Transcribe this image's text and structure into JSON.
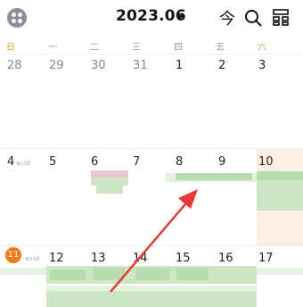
{
  "header": {
    "month": "2023.06",
    "today_label": "今",
    "icons": {
      "menu": "dots-grid-icon",
      "search": "search-icon",
      "layout": "layout-grid-icon"
    }
  },
  "weekdays": [
    "日",
    "一",
    "二",
    "三",
    "四",
    "五",
    "六"
  ],
  "weeks": [
    {
      "days": [
        "28",
        "29",
        "30",
        "31",
        "1",
        "2",
        "3"
      ],
      "weeknum": ""
    },
    {
      "days": [
        "4",
        "5",
        "6",
        "7",
        "8",
        "9",
        "10"
      ],
      "weeknum": "第23周"
    },
    {
      "days": [
        "11",
        "12",
        "13",
        "14",
        "15",
        "16",
        "17"
      ],
      "weeknum": "第24周"
    }
  ],
  "today": "11",
  "colors": {
    "accent": "#f07a1a",
    "weekend": "#e8a23a",
    "event_green": "#cfe6c4",
    "event_pink": "#ecc6c8",
    "arrow": "#e53935"
  }
}
